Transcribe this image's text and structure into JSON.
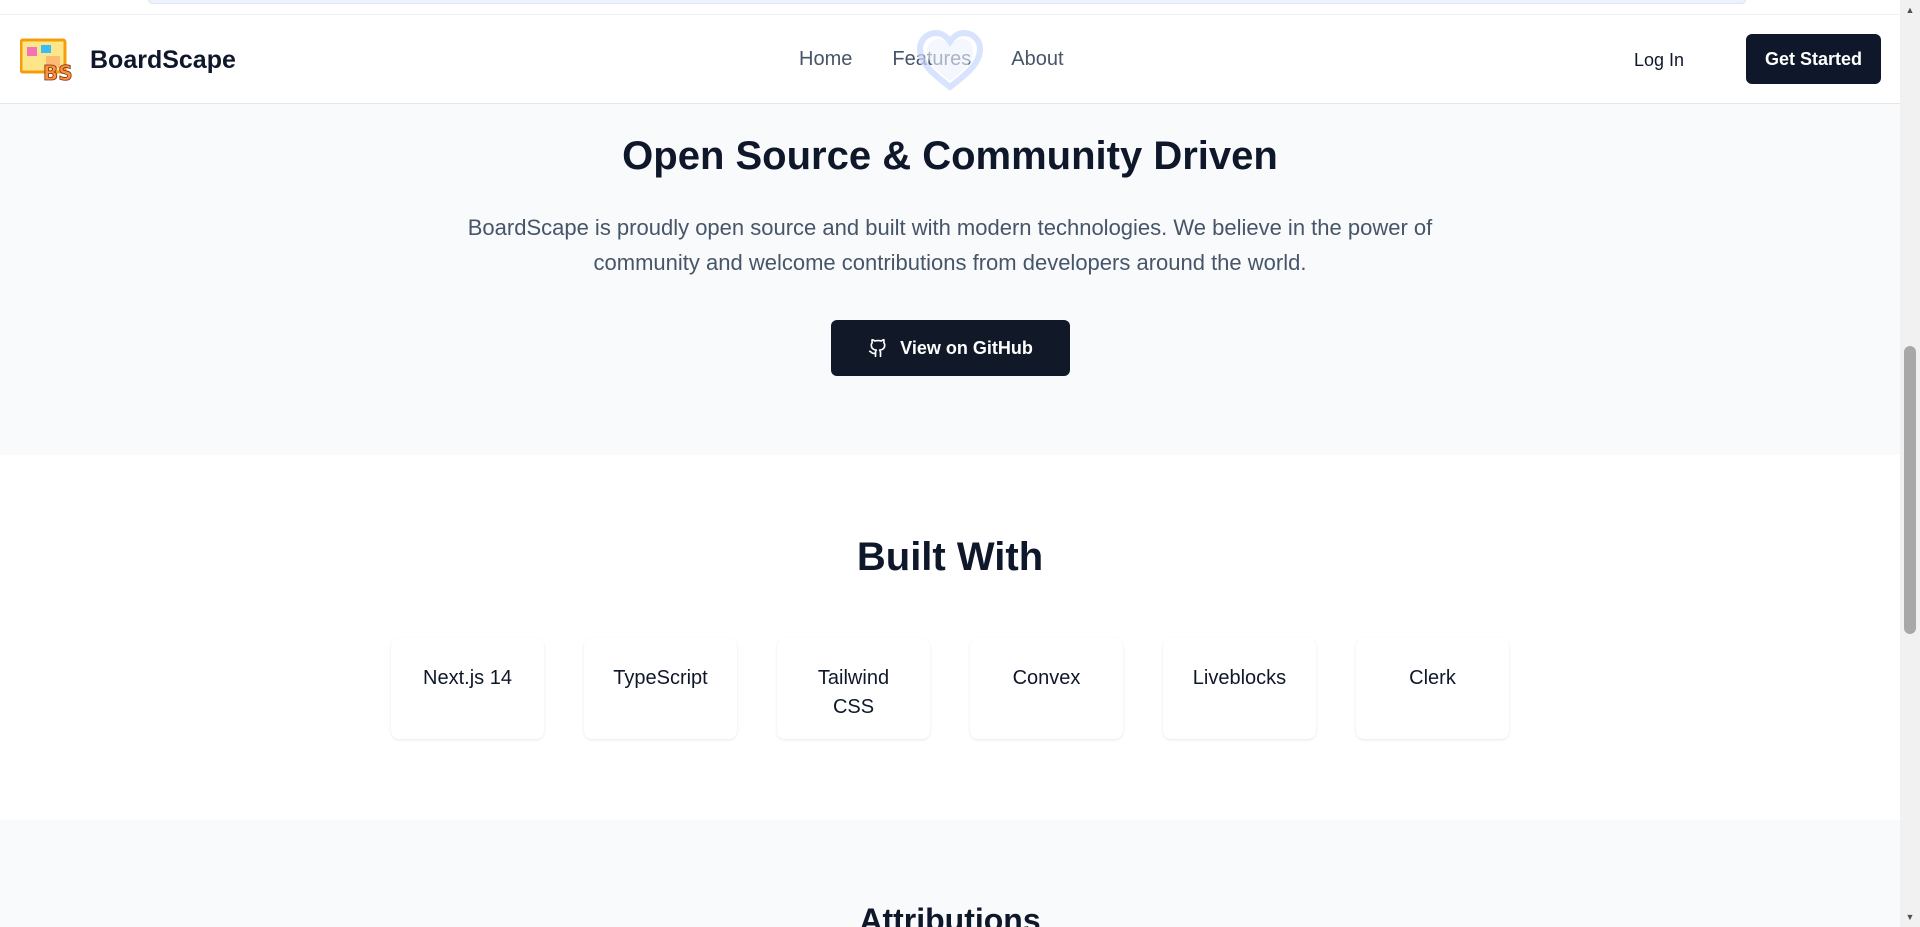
{
  "header": {
    "brand_name": "BoardScape",
    "logo_text": "BS",
    "nav": {
      "home": "Home",
      "features": "Features",
      "about": "About"
    },
    "login_label": "Log In",
    "get_started_label": "Get Started"
  },
  "open_source": {
    "title": "Open Source & Community Driven",
    "description": "BoardScape is proudly open source and built with modern technologies. We believe in the power of community and welcome contributions from developers around the world.",
    "github_button_label": "View on GitHub"
  },
  "built_with": {
    "title": "Built With",
    "technologies": [
      "Next.js 14",
      "TypeScript",
      "Tailwind CSS",
      "Convex",
      "Liveblocks",
      "Clerk"
    ]
  },
  "attributions": {
    "title": "Attributions"
  },
  "colors": {
    "primary_dark": "#0f172a",
    "muted_text": "#475569",
    "section_bg": "#f8fafc"
  }
}
